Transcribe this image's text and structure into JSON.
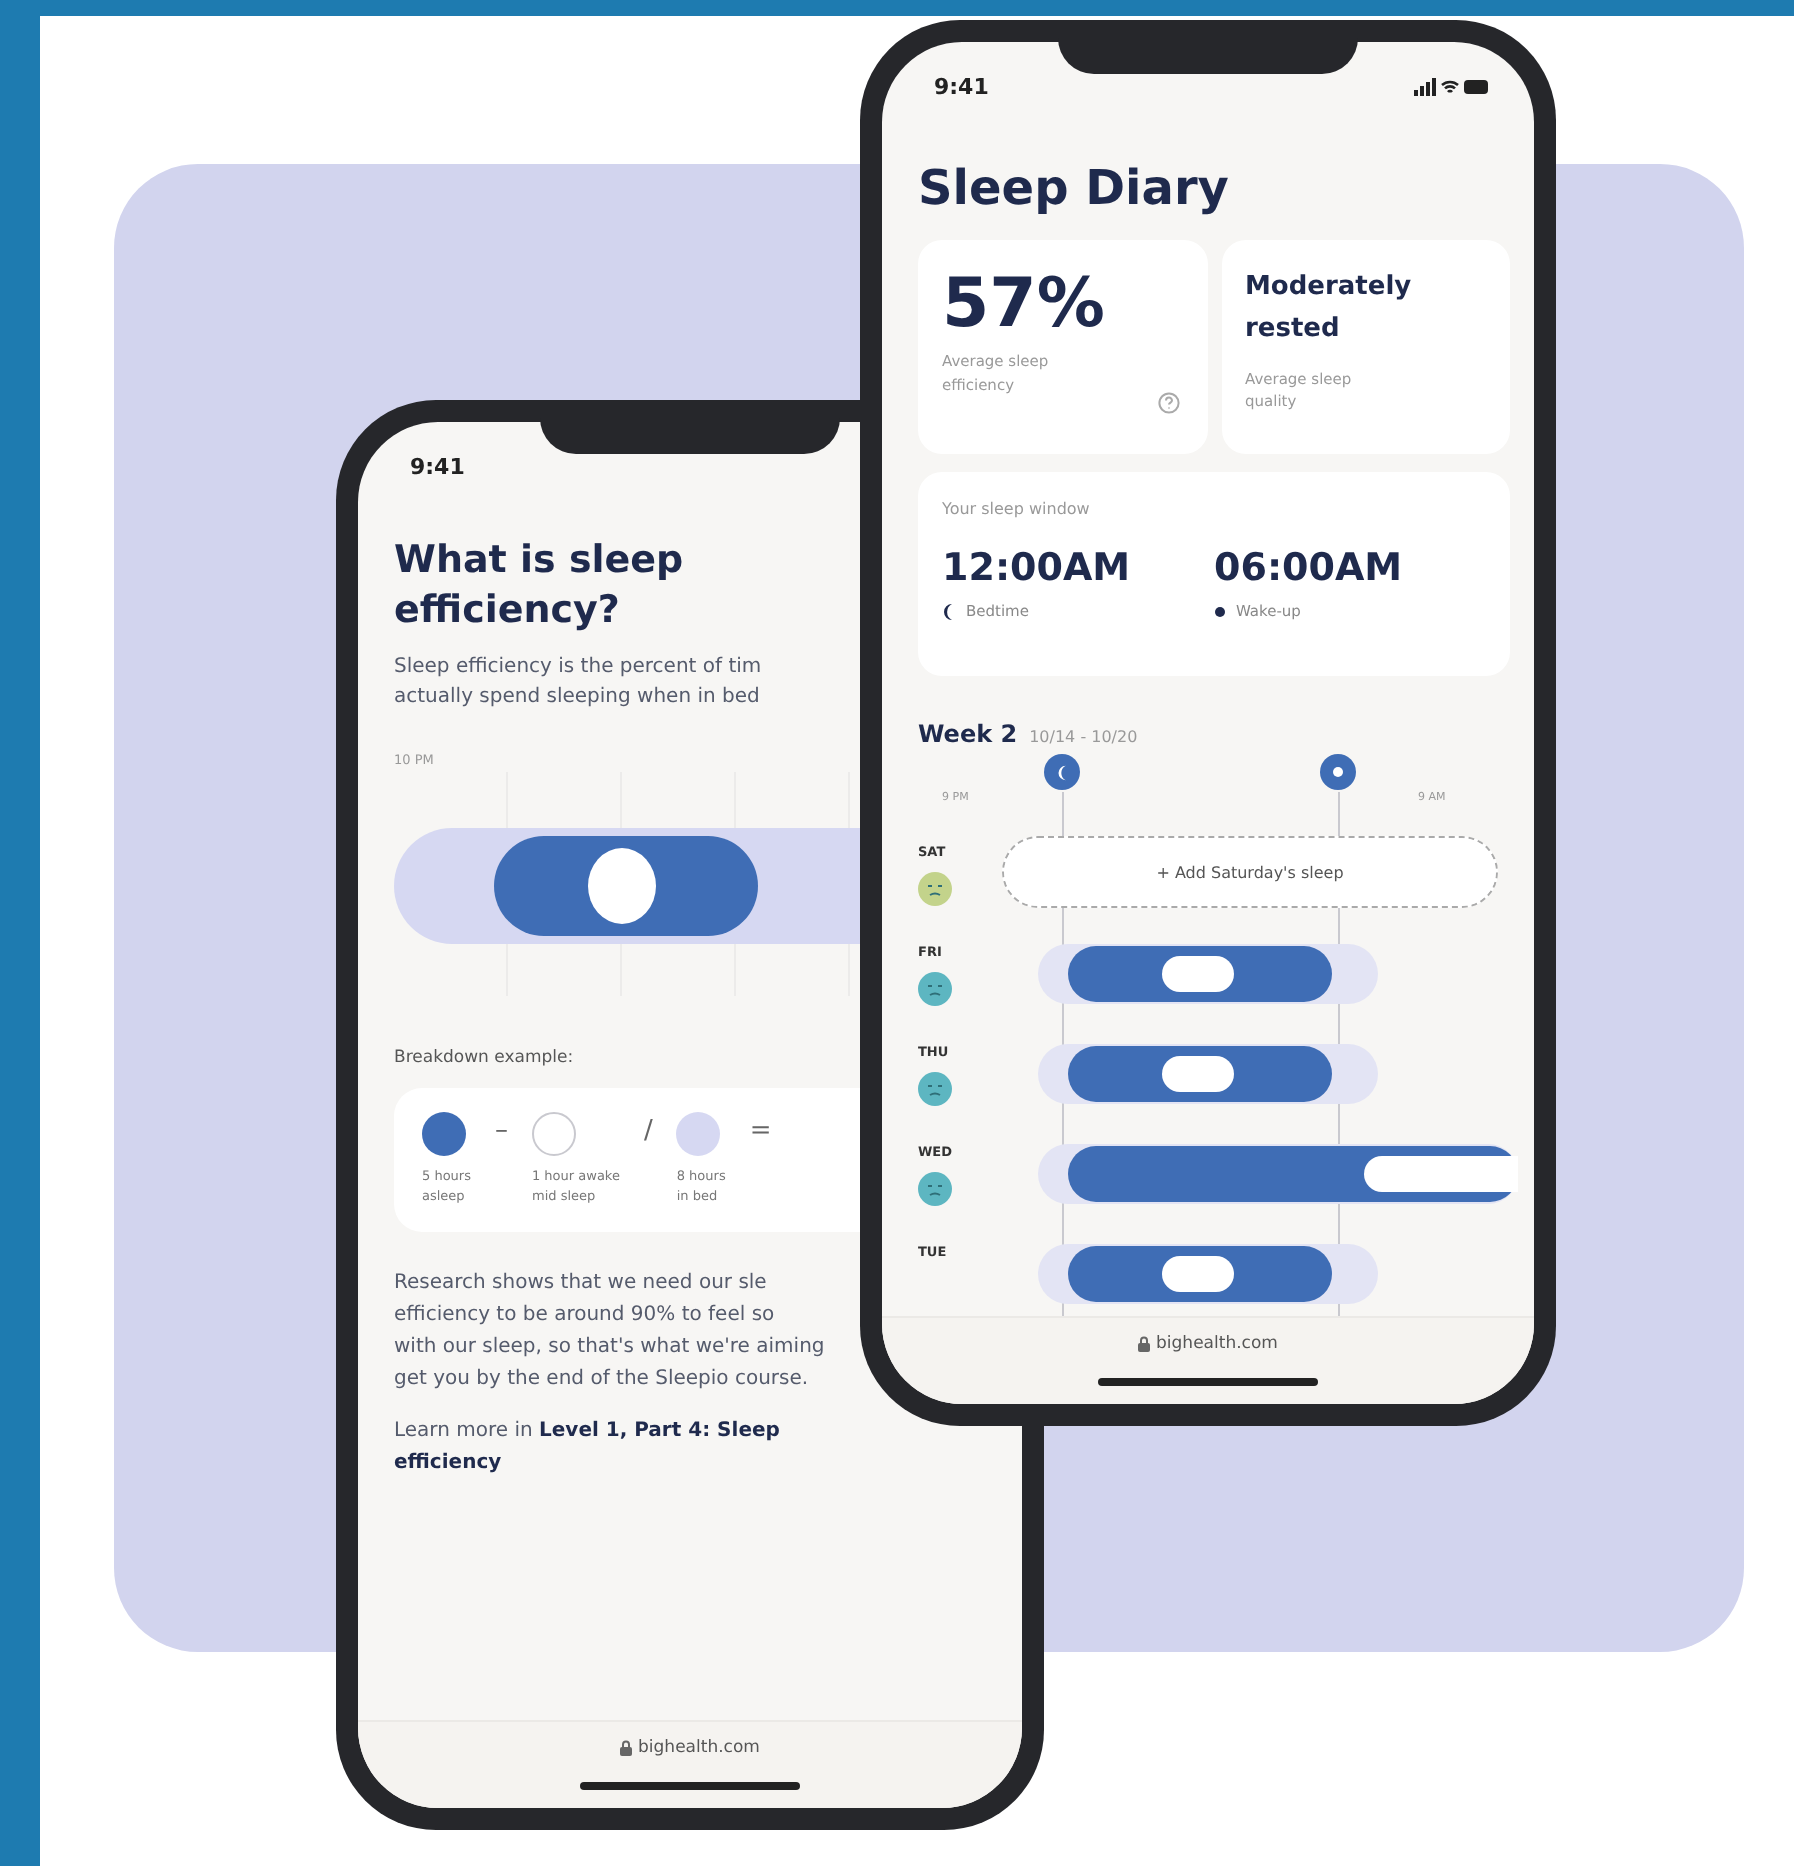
{
  "back_phone": {
    "status_time": "9:41",
    "title": "What is sleep\nefficiency?",
    "intro": "Sleep efficiency is the percent of tim\nactually spend sleeping when in bed",
    "chart_label": "10 PM",
    "breakdown_label": "Breakdown example:",
    "breakdown": [
      {
        "kind": "asleep",
        "caption": "5 hours\nasleep"
      },
      {
        "kind": "symbol",
        "text": "–"
      },
      {
        "kind": "awake",
        "caption": "1 hour awake\nmid sleep"
      },
      {
        "kind": "symbol",
        "text": "/"
      },
      {
        "kind": "in_bed",
        "caption": "8 hours\nin bed"
      },
      {
        "kind": "symbol",
        "text": "="
      }
    ],
    "research": "Research shows that we need our sle\nefficiency to be around 90% to feel so\nwith our sleep, so that's what we're aiming\nget you by the end of the Sleepio course.",
    "learn_more": "Learn more in **Level 1, Part 4: Sleep efficiency**",
    "footer": "bighealth.com"
  },
  "front_phone": {
    "status_time": "9:41",
    "title": "Sleep Diary",
    "stats": [
      {
        "kind": "percent",
        "value": "57%",
        "caption": "Average sleep\nefficiency",
        "info": true
      },
      {
        "kind": "text",
        "value": "Moderately\nrested",
        "caption": "Average sleep\nquality",
        "info": false
      }
    ],
    "sleep_window": {
      "label": "Your sleep window",
      "times": [
        {
          "kind": "bedtime",
          "time": "12:00AM",
          "caption": "Bedtime"
        },
        {
          "kind": "wake",
          "time": "06:00AM",
          "caption": "Wake-up"
        }
      ]
    },
    "week": {
      "title": "Week 2",
      "range": "10/14 - 10/20",
      "axis_start": "9 PM",
      "axis_end": "9 AM",
      "days": [
        {
          "label": "SAT",
          "kind": "add",
          "color": "#c3d38b",
          "action": "+ Add Saturday's sleep"
        },
        {
          "label": "FRI",
          "kind": "night",
          "color": "#5db6c1"
        },
        {
          "label": "THU",
          "kind": "night",
          "color": "#5db6c1"
        },
        {
          "label": "WED",
          "kind": "late",
          "color": "#5db6c1"
        },
        {
          "label": "TUE",
          "kind": "night"
        }
      ]
    },
    "footer": "bighealth.com"
  }
}
